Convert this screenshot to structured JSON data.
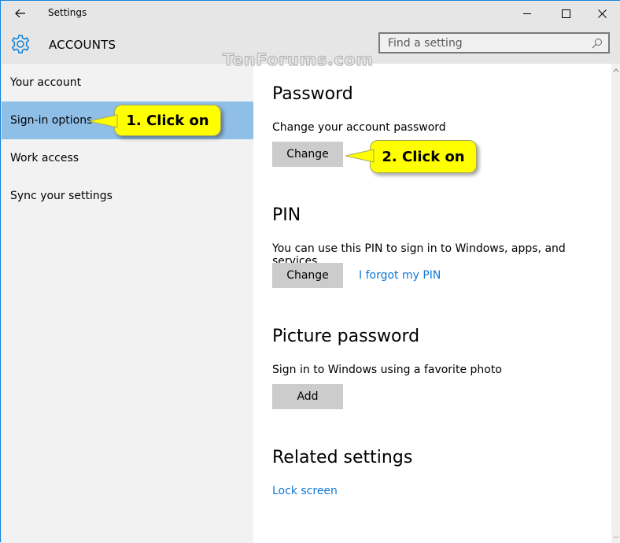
{
  "window": {
    "title": "Settings",
    "controls": {
      "minimize": "minimize",
      "maximize": "maximize",
      "close": "close"
    }
  },
  "header": {
    "icon": "gear-icon",
    "title": "ACCOUNTS",
    "search": {
      "placeholder": "Find a setting",
      "value": ""
    }
  },
  "watermark": "TenForums.com",
  "sidebar": {
    "items": [
      {
        "label": "Your account",
        "selected": false
      },
      {
        "label": "Sign-in options",
        "selected": true
      },
      {
        "label": "Work access",
        "selected": false
      },
      {
        "label": "Sync your settings",
        "selected": false
      }
    ]
  },
  "content": {
    "password": {
      "heading": "Password",
      "description": "Change your account password",
      "button": "Change"
    },
    "pin": {
      "heading": "PIN",
      "description": "You can use this PIN to sign in to Windows, apps, and services.",
      "button": "Change",
      "link": "I forgot my PIN"
    },
    "picture_password": {
      "heading": "Picture password",
      "description": "Sign in to Windows using a favorite photo",
      "button": "Add"
    },
    "related": {
      "heading": "Related settings",
      "link": "Lock screen"
    }
  },
  "callouts": [
    {
      "text": "1. Click on"
    },
    {
      "text": "2. Click on"
    }
  ],
  "colors": {
    "accent": "#1883d7",
    "selected_nav": "#8fbfe6",
    "link": "#0f78d7",
    "button": "#cccccc",
    "callout": "#ffff00"
  }
}
